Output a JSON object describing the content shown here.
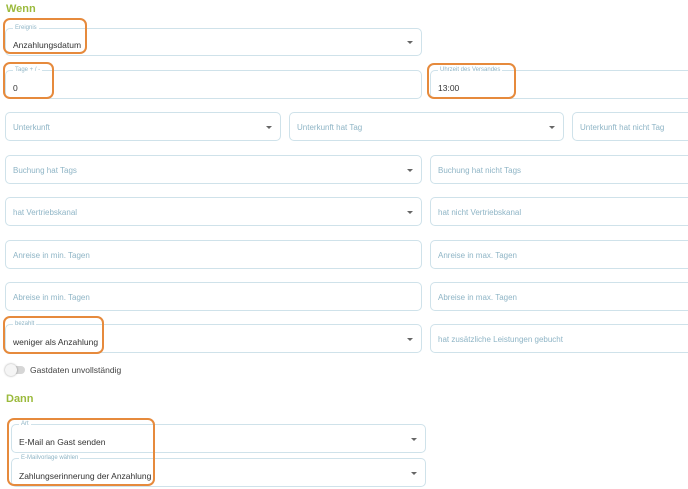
{
  "wenn": {
    "title": "Wenn",
    "ereignis": {
      "label": "Ereignis",
      "value": "Anzahlungsdatum"
    },
    "tage": {
      "label": "Tage + / -",
      "value": "0"
    },
    "uhrzeit": {
      "label": "Uhrzeit des Versandes",
      "value": "13:00"
    },
    "unterkunft": {
      "placeholder": "Unterkunft"
    },
    "unterkunft_hat_tag": {
      "placeholder": "Unterkunft hat Tag"
    },
    "unterkunft_hat_nicht_tag": {
      "placeholder": "Unterkunft hat nicht Tag"
    },
    "buchung_hat_tags": {
      "placeholder": "Buchung hat Tags"
    },
    "buchung_hat_nicht_tags": {
      "placeholder": "Buchung hat nicht Tags"
    },
    "hat_vertriebskanal": {
      "placeholder": "hat Vertriebskanal"
    },
    "hat_nicht_vertriebskanal": {
      "placeholder": "hat nicht Vertriebskanal"
    },
    "anreise_min": {
      "placeholder": "Anreise in min. Tagen"
    },
    "anreise_max": {
      "placeholder": "Anreise in max. Tagen"
    },
    "abreise_min": {
      "placeholder": "Abreise in min. Tagen"
    },
    "abreise_max": {
      "placeholder": "Abreise in max. Tagen"
    },
    "bezahlt": {
      "label": "bezahlt",
      "value": "weniger als Anzahlung"
    },
    "zusaetzliche_leistungen": {
      "placeholder": "hat zusätzliche Leistungen gebucht"
    },
    "gastdaten_toggle": {
      "label": "Gastdaten unvollständig",
      "on": false
    }
  },
  "dann": {
    "title": "Dann",
    "art": {
      "label": "Art",
      "value": "E-Mail an Gast senden"
    },
    "vorlage": {
      "label": "E-Mailvorlage wählen",
      "value": "Zahlungserinnerung der Anzahlung"
    }
  },
  "colors": {
    "accent_green": "#9bba3c",
    "highlight_orange": "#e68a3c",
    "border_blue": "#cfe2ea"
  }
}
